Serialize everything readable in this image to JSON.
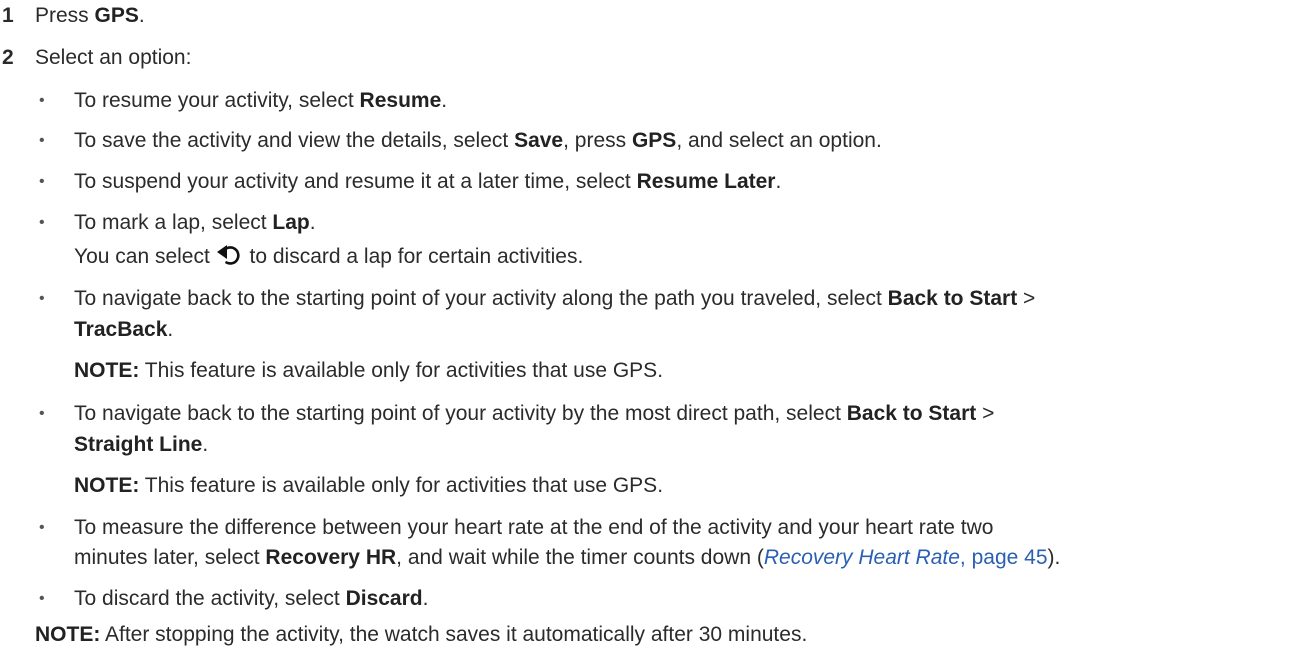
{
  "steps": [
    {
      "num": "1",
      "pre": "Press ",
      "bold": "GPS",
      "post": "."
    },
    {
      "num": "2",
      "text": "Select an option:"
    }
  ],
  "bullets": {
    "resume": {
      "pre": "To resume your activity, select ",
      "bold": "Resume",
      "post": "."
    },
    "save": {
      "pre": "To save the activity and view the details, select ",
      "bold1": "Save",
      "mid": ", press ",
      "bold2": "GPS",
      "post": ", and select an option."
    },
    "resume_later": {
      "pre": "To suspend your activity and resume it at a later time, select ",
      "bold": "Resume Later",
      "post": "."
    },
    "lap": {
      "pre": "To mark a lap, select ",
      "bold": "Lap",
      "post": ".",
      "cont_pre": "You can select ",
      "cont_icon": "undo-icon",
      "cont_post": " to discard a lap for certain activities."
    },
    "tracback": {
      "pre": "To navigate back to the starting point of your activity along the path you traveled, select ",
      "bold1": "Back to Start",
      "sep": " >",
      "bold2": "TracBack",
      "post": ".",
      "note_label": "NOTE:",
      "note_text": " This feature is available only for activities that use GPS."
    },
    "straight": {
      "pre": "To navigate back to the starting point of your activity by the most direct path, select ",
      "bold1": "Back to Start",
      "sep": " >",
      "bold2": "Straight Line",
      "post": ".",
      "note_label": "NOTE:",
      "note_text": " This feature is available only for activities that use GPS."
    },
    "recovery": {
      "line1": "To measure the difference between your heart rate at the end of the activity and your heart rate two",
      "pre": "minutes later, select ",
      "bold": "Recovery HR",
      "mid": ", and wait while the timer counts down (",
      "link_title": "Recovery Heart Rate",
      "link_page": ", page 45",
      "post": ")."
    },
    "discard": {
      "pre": "To discard the activity, select ",
      "bold": "Discard",
      "post": "."
    }
  },
  "final_note": {
    "label": "NOTE:",
    "text": " After stopping the activity, the watch saves it automatically after 30 minutes."
  },
  "bullet_char": "•",
  "colors": {
    "text": "#2b2b2b",
    "link": "#2a5fb3"
  }
}
